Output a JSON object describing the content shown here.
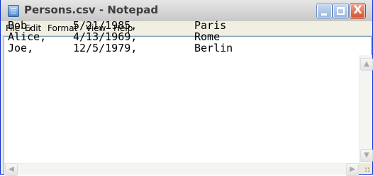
{
  "window": {
    "title": "Persons.csv - Notepad"
  },
  "titlebar_buttons": {
    "close_glyph": "X"
  },
  "menu": {
    "items": [
      {
        "label": "File"
      },
      {
        "label": "Edit"
      },
      {
        "label": "Format"
      },
      {
        "label": "View"
      },
      {
        "label": "Help"
      }
    ]
  },
  "document": {
    "rows": [
      [
        "Bob,",
        "5/21/1985,",
        "Paris"
      ],
      [
        "Alice,",
        "4/13/1969,",
        "Rome"
      ],
      [
        "Joe,",
        "12/5/1979,",
        "Berlin"
      ]
    ]
  },
  "icons": {
    "app": "notepad-icon",
    "minimize": "minimize-icon",
    "maximize": "maximize-icon",
    "close": "close-icon",
    "scroll_up": "arrow-up-icon",
    "scroll_down": "arrow-down-icon",
    "scroll_left": "arrow-left-icon",
    "scroll_right": "arrow-right-icon",
    "resize": "resize-grip-icon"
  },
  "colors": {
    "window_frame": "#0831d9",
    "editor_background": "#ffffff",
    "close_button": "#d6512c"
  }
}
